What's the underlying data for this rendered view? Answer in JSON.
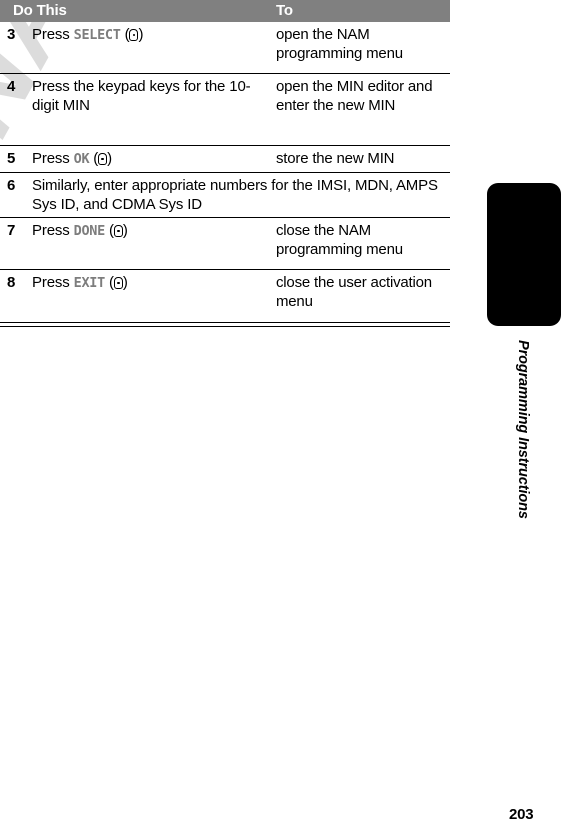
{
  "document": {
    "page_number": "203",
    "chapter_label": "Programming Instructions",
    "watermark": "PRELIMINARY"
  },
  "table": {
    "headers": {
      "do_this": "Do This",
      "to": "To"
    },
    "rows": [
      {
        "step": "3",
        "do_prefix": "Press ",
        "do_softkey": "SELECT",
        "do_suffix_open": " (",
        "do_suffix_close": ")",
        "key_icon": "soft-key-icon",
        "to": "open the NAM programming menu",
        "full_width": false
      },
      {
        "step": "4",
        "do_prefix": "Press the keypad keys for the 10-digit MIN",
        "do_softkey": "",
        "do_suffix_open": "",
        "do_suffix_close": "",
        "key_icon": "",
        "to": "open the MIN editor and enter the new MIN",
        "full_width": false
      },
      {
        "step": "5",
        "do_prefix": "Press ",
        "do_softkey": "OK",
        "do_suffix_open": " (",
        "do_suffix_close": ")",
        "key_icon": "soft-key-icon",
        "to": "store the new MIN",
        "full_width": false
      },
      {
        "step": "6",
        "do_prefix": "Similarly, enter appropriate numbers for the IMSI, MDN, AMPS Sys ID, and CDMA Sys ID",
        "do_softkey": "",
        "do_suffix_open": "",
        "do_suffix_close": "",
        "key_icon": "",
        "to": "",
        "full_width": true
      },
      {
        "step": "7",
        "do_prefix": "Press ",
        "do_softkey": "DONE",
        "do_suffix_open": " (",
        "do_suffix_close": ")",
        "key_icon": "soft-key-icon",
        "to": "close the NAM programming menu",
        "full_width": false
      },
      {
        "step": "8",
        "do_prefix": "Press ",
        "do_softkey": "EXIT",
        "do_suffix_open": " (",
        "do_suffix_close": ")",
        "key_icon": "soft-key-icon",
        "to": "close the user activation menu",
        "full_width": false
      }
    ]
  },
  "colors": {
    "header_bar": "#808080",
    "header_text": "#ffffff",
    "softkey_text": "#7d7d7d",
    "watermark": "#dcdcdc",
    "tab": "#000000",
    "body_text": "#000000"
  }
}
